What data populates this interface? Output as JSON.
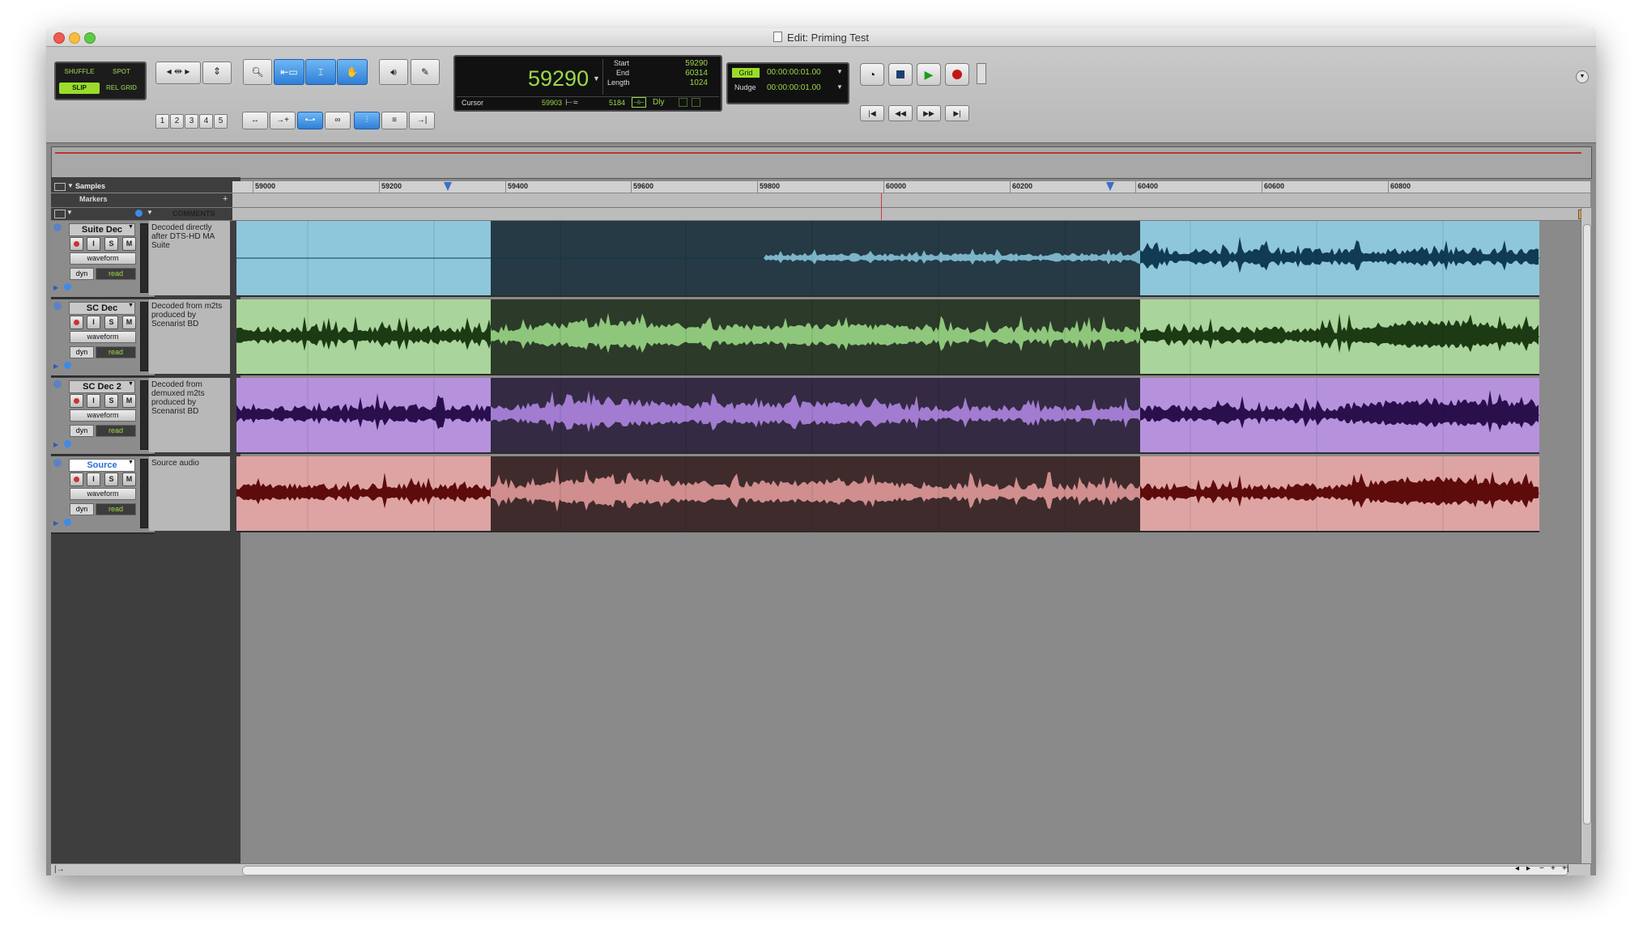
{
  "window": {
    "title": "Edit: Priming Test"
  },
  "modes": {
    "shuffle": "SHUFFLE",
    "spot": "SPOT",
    "slip": "SLIP",
    "relgrid": "REL GRID"
  },
  "zoom_presets": [
    "1",
    "2",
    "3",
    "4",
    "5"
  ],
  "counter": {
    "main": "59290",
    "start_label": "Start",
    "start": "59290",
    "end_label": "End",
    "end": "60314",
    "length_label": "Length",
    "length": "1024",
    "cursor_label": "Cursor",
    "cursor": "59903",
    "cursor2": "5184",
    "dly": "Dly"
  },
  "grid": {
    "label": "Grid",
    "value": "00:00:00:01.00",
    "nudge_label": "Nudge",
    "nudge_value": "00:00:00:01.00"
  },
  "ruler": {
    "name": "Samples",
    "ticks": [
      "59000",
      "59200",
      "59400",
      "59600",
      "59800",
      "60000",
      "60200",
      "60400",
      "60600",
      "60800"
    ]
  },
  "markers_label": "Markers",
  "comments_header": "COMMENTS",
  "tracks": [
    {
      "name": "Suite Dec",
      "view": "waveform",
      "dyn": "dyn",
      "auto": "read",
      "comment": "Decoded directly after DTS-HD MA Suite",
      "color_light": "#8ec7dc",
      "color_dark": "#253a44",
      "wave_light": "#103b52",
      "wave_dark": "#7bb5c9"
    },
    {
      "name": "SC Dec",
      "view": "waveform",
      "dyn": "dyn",
      "auto": "read",
      "comment": "Decoded from m2ts produced by Scenarist BD",
      "color_light": "#a9d49b",
      "color_dark": "#2c3a29",
      "wave_light": "#1c3a14",
      "wave_dark": "#8ec77b"
    },
    {
      "name": "SC Dec 2",
      "view": "waveform",
      "dyn": "dyn",
      "auto": "read",
      "comment": "Decoded from demuxed m2ts produced by Scenarist BD",
      "color_light": "#b692dd",
      "color_dark": "#342a43",
      "wave_light": "#2a0f4d",
      "wave_dark": "#a27cd0"
    },
    {
      "name": "Source",
      "view": "waveform",
      "dyn": "dyn",
      "auto": "read",
      "comment": "Source audio",
      "color_light": "#dea4a4",
      "color_dark": "#3f2b2b",
      "wave_light": "#5e0b0b",
      "wave_dark": "#d08e8e"
    }
  ],
  "buttons": {
    "input": "I",
    "solo": "S",
    "mute": "M"
  }
}
